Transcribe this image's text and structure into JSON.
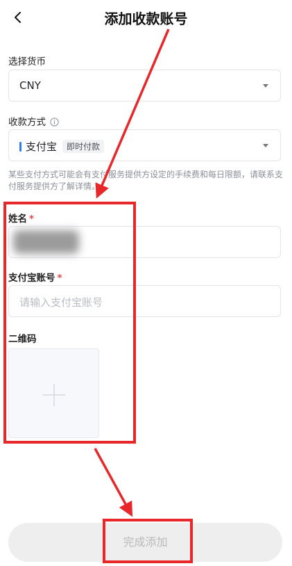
{
  "header": {
    "title": "添加收款账号",
    "back_icon": "chevron-left-icon"
  },
  "currency": {
    "label": "选择货币",
    "value": "CNY"
  },
  "payment_method": {
    "label": "收款方式",
    "info_icon": "info-icon",
    "name": "支付宝",
    "tag": "即时付款"
  },
  "note": "某些支付方式可能会有支付服务提供方设定的手续费和每日限额，请联系支付服务提供方了解详情。",
  "name_field": {
    "label": "姓名",
    "required_mark": "*"
  },
  "account_field": {
    "label": "支付宝账号",
    "required_mark": "*",
    "placeholder": "请输入支付宝账号"
  },
  "qr": {
    "label": "二维码",
    "add_icon": "plus-icon"
  },
  "submit_label": "完成添加",
  "colors": {
    "annotation": "#e8272a",
    "payment_accent": "#2f7bf5",
    "required": "#e5484d"
  }
}
